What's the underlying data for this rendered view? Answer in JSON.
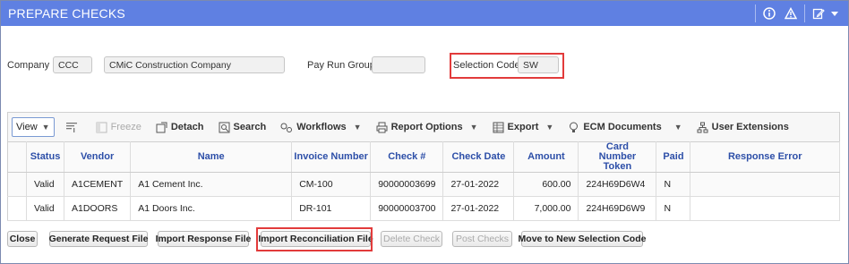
{
  "window": {
    "title": "PREPARE CHECKS"
  },
  "header": {
    "company_label": "Company",
    "company_code": "CCC",
    "company_name": "CMiC Construction Company",
    "pay_run_group_label": "Pay Run Group",
    "pay_run_group_value": "",
    "selection_code_label": "Selection Code",
    "selection_code_value": "SW"
  },
  "toolbar": {
    "view": "View",
    "freeze": "Freeze",
    "detach": "Detach",
    "search": "Search",
    "workflows": "Workflows",
    "report_options": "Report Options",
    "export": "Export",
    "ecm_documents": "ECM Documents",
    "user_extensions": "User Extensions"
  },
  "grid": {
    "columns": [
      "Status",
      "Vendor",
      "Name",
      "Invoice Number",
      "Check #",
      "Check Date",
      "Amount",
      "Card Number Token",
      "Paid",
      "Response Error"
    ],
    "rows": [
      {
        "status": "Valid",
        "vendor": "A1CEMENT",
        "name": "A1 Cement Inc.",
        "invoice": "CM-100",
        "check": "90000003699",
        "date": "27-01-2022",
        "amount": "600.00",
        "token": "224H69D6W4",
        "paid": "N",
        "error": ""
      },
      {
        "status": "Valid",
        "vendor": "A1DOORS",
        "name": "A1 Doors Inc.",
        "invoice": "DR-101",
        "check": "90000003700",
        "date": "27-01-2022",
        "amount": "7,000.00",
        "token": "224H69D6W9",
        "paid": "N",
        "error": ""
      }
    ]
  },
  "buttons": {
    "close": "Close",
    "generate": "Generate Request File",
    "import_response": "Import Response File",
    "import_reconciliation": "Import Reconciliation File",
    "delete_check": "Delete Check",
    "post_checks": "Post Checks",
    "move_selection": "Move to New Selection Code"
  },
  "colors": {
    "titlebar": "#5f80e2",
    "highlight": "#e23b3b",
    "header_text": "#2d4fa8"
  }
}
